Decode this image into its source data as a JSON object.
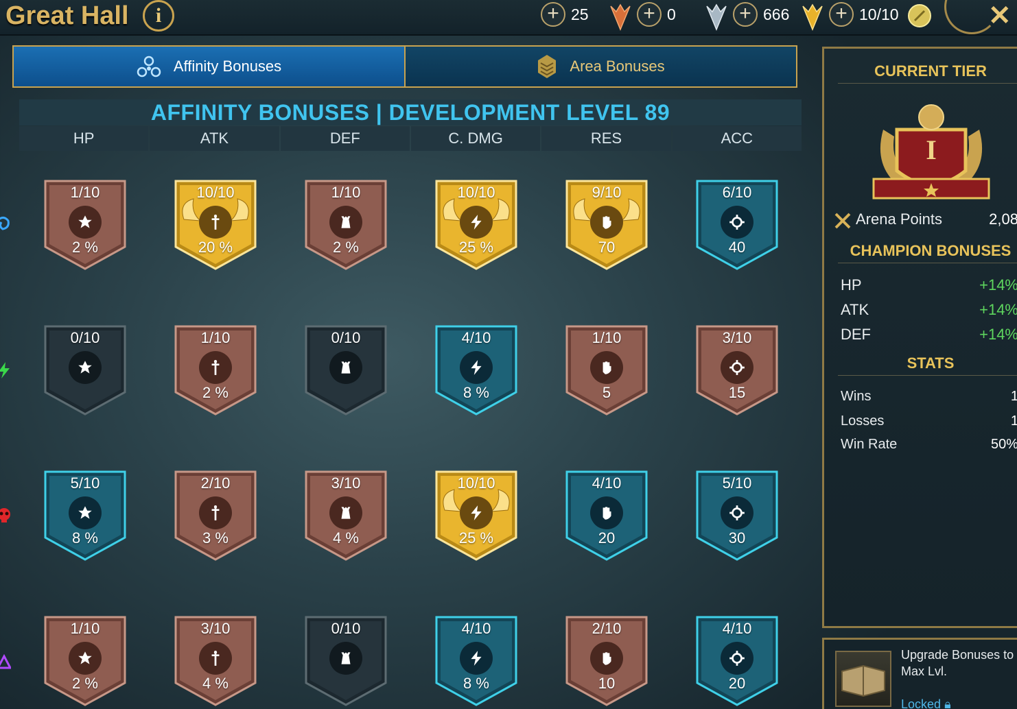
{
  "header": {
    "title": "Great Hall",
    "info_label": "i",
    "close_label": "✕"
  },
  "resources": [
    {
      "value": "25",
      "icon": "bronze-medal-icon"
    },
    {
      "value": "0",
      "icon": "silver-medal-icon"
    },
    {
      "value": "666",
      "icon": "gold-medal-icon"
    },
    {
      "value": "10/10",
      "icon": "arena-token-icon"
    }
  ],
  "tabs": {
    "affinity": "Affinity Bonuses",
    "area": "Area Bonuses"
  },
  "banner": "AFFINITY BONUSES | DEVELOPMENT LEVEL 89",
  "columns": [
    "HP",
    "ATK",
    "DEF",
    "C. DMG",
    "RES",
    "ACC"
  ],
  "column_icons": [
    "hp-icon",
    "sword-icon",
    "tower-icon",
    "lightning-icon",
    "fist-icon",
    "crosshair-icon"
  ],
  "affinities": [
    "magic",
    "spirit",
    "force",
    "void"
  ],
  "grid": [
    [
      {
        "level": "1/10",
        "value": "2 %",
        "tier": "bronze"
      },
      {
        "level": "10/10",
        "value": "20 %",
        "tier": "gold"
      },
      {
        "level": "1/10",
        "value": "2 %",
        "tier": "bronze"
      },
      {
        "level": "10/10",
        "value": "25 %",
        "tier": "gold"
      },
      {
        "level": "9/10",
        "value": "70",
        "tier": "gold"
      },
      {
        "level": "6/10",
        "value": "40",
        "tier": "blue"
      }
    ],
    [
      {
        "level": "0/10",
        "value": "",
        "tier": "empty"
      },
      {
        "level": "1/10",
        "value": "2 %",
        "tier": "bronze"
      },
      {
        "level": "0/10",
        "value": "",
        "tier": "empty"
      },
      {
        "level": "4/10",
        "value": "8 %",
        "tier": "blue"
      },
      {
        "level": "1/10",
        "value": "5",
        "tier": "bronze"
      },
      {
        "level": "3/10",
        "value": "15",
        "tier": "bronze"
      }
    ],
    [
      {
        "level": "5/10",
        "value": "8 %",
        "tier": "blue"
      },
      {
        "level": "2/10",
        "value": "3 %",
        "tier": "bronze"
      },
      {
        "level": "3/10",
        "value": "4 %",
        "tier": "bronze"
      },
      {
        "level": "10/10",
        "value": "25 %",
        "tier": "gold"
      },
      {
        "level": "4/10",
        "value": "20",
        "tier": "blue"
      },
      {
        "level": "5/10",
        "value": "30",
        "tier": "blue"
      }
    ],
    [
      {
        "level": "1/10",
        "value": "2 %",
        "tier": "bronze"
      },
      {
        "level": "3/10",
        "value": "4 %",
        "tier": "bronze"
      },
      {
        "level": "0/10",
        "value": "",
        "tier": "empty"
      },
      {
        "level": "4/10",
        "value": "8 %",
        "tier": "blue"
      },
      {
        "level": "2/10",
        "value": "10",
        "tier": "bronze"
      },
      {
        "level": "4/10",
        "value": "20",
        "tier": "blue"
      }
    ]
  ],
  "panel": {
    "current_tier": "CURRENT TIER",
    "tier_numeral": "I",
    "arena_points_label": "Arena Points",
    "arena_points_value": "2,08",
    "champion_bonuses": "CHAMPION BONUSES",
    "bonuses": [
      {
        "k": "HP",
        "v": "+14%"
      },
      {
        "k": "ATK",
        "v": "+14%"
      },
      {
        "k": "DEF",
        "v": "+14%"
      }
    ],
    "stats_title": "STATS",
    "stats": [
      {
        "k": "Wins",
        "v": "1"
      },
      {
        "k": "Losses",
        "v": "1"
      },
      {
        "k": "Win Rate",
        "v": "50%"
      }
    ],
    "upgrade_text": "Upgrade Bonuses to Max Lvl.",
    "locked": "Locked"
  },
  "colors": {
    "gold": "#e8b22a",
    "bronze": "#8c5a4e",
    "blue": "#1c5d73",
    "empty": "#24323a",
    "accent_blue": "#40c4ef",
    "green": "#5ed65e"
  }
}
